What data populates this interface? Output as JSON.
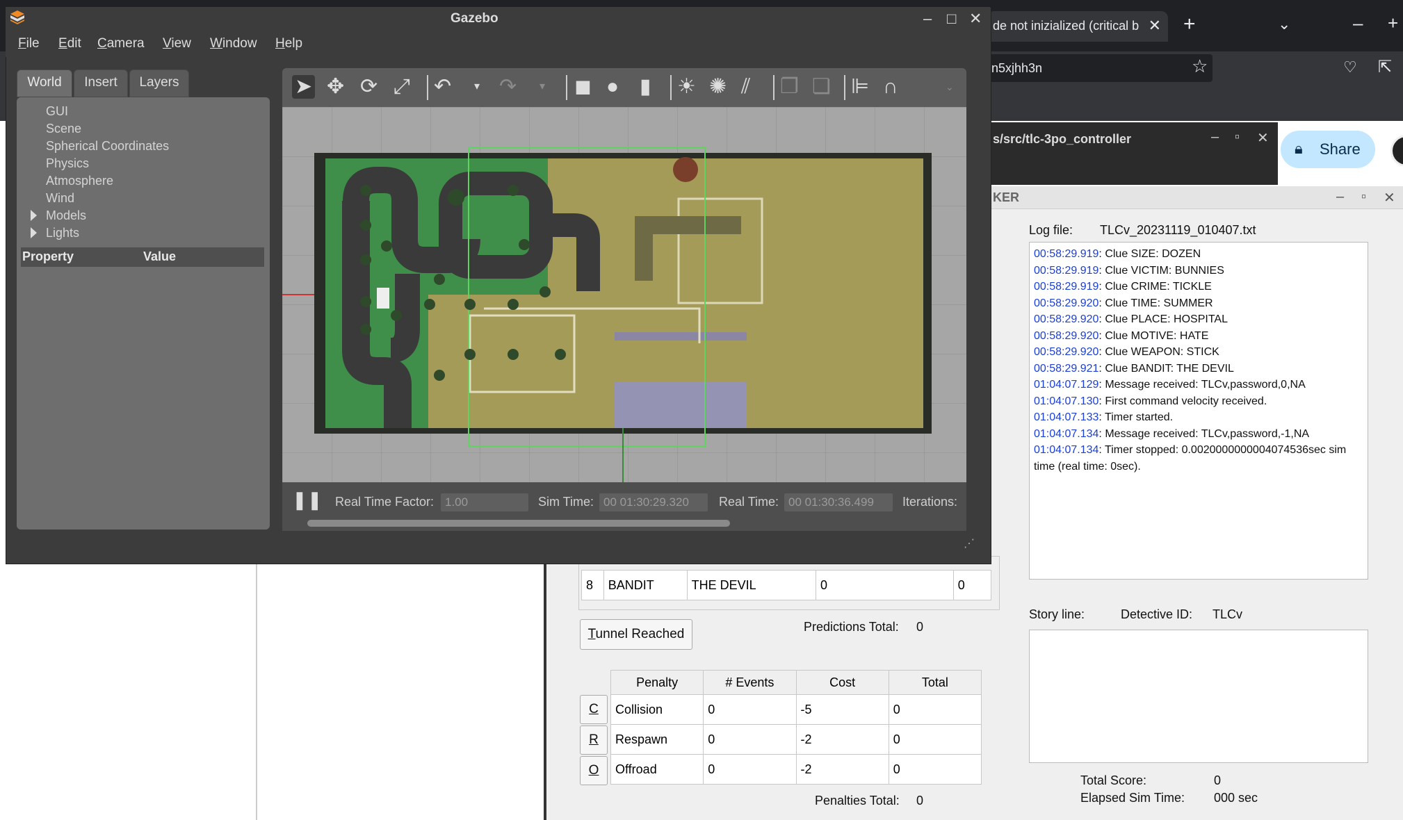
{
  "browser": {
    "tab_title": "de not inizialized (critical b",
    "tab_close": "✕",
    "new_tab": "+",
    "tab_dropdown": "⌄",
    "minimize": "–",
    "plus": "+",
    "url_text": "n5xjhh3n",
    "share_label": "Share"
  },
  "terminal": {
    "title": "s/src/tlc-3po_controller",
    "min": "–",
    "max": "▫",
    "close": "✕"
  },
  "tracker": {
    "title": "KER",
    "min": "–",
    "max": "▫",
    "close": "✕",
    "log_file_label": "Log file:",
    "log_file_name": "TLCv_20231119_010407.txt",
    "log": [
      {
        "ts": "00:58:29.919",
        "msg": ": Clue SIZE: DOZEN"
      },
      {
        "ts": "00:58:29.919",
        "msg": ": Clue VICTIM: BUNNIES"
      },
      {
        "ts": "00:58:29.919",
        "msg": ": Clue CRIME: TICKLE"
      },
      {
        "ts": "00:58:29.920",
        "msg": ": Clue TIME: SUMMER"
      },
      {
        "ts": "00:58:29.920",
        "msg": ": Clue PLACE: HOSPITAL"
      },
      {
        "ts": "00:58:29.920",
        "msg": ": Clue MOTIVE: HATE"
      },
      {
        "ts": "00:58:29.920",
        "msg": ": Clue WEAPON: STICK"
      },
      {
        "ts": "00:58:29.921",
        "msg": ": Clue BANDIT: THE DEVIL"
      },
      {
        "ts": "01:04:07.129",
        "msg": ": Message received: TLCv,password,0,NA"
      },
      {
        "ts": "01:04:07.130",
        "msg": ": First command velocity received."
      },
      {
        "ts": "01:04:07.133",
        "msg": ": Timer started."
      },
      {
        "ts": "01:04:07.134",
        "msg": ": Message received: TLCv,password,-1,NA"
      },
      {
        "ts": "01:04:07.134",
        "msg": ": Timer stopped: 0.0020000000004074536sec sim"
      },
      {
        "ts": "",
        "msg": "time (real time: 0sec)."
      }
    ],
    "clue_row": {
      "num": "8",
      "type": "BANDIT",
      "value": "THE DEVIL",
      "pred": "0",
      "pts": "0"
    },
    "tunnel_button": "Tunnel Reached",
    "tunnel_underline": "T",
    "tunnel_rest": "unnel Reached",
    "predictions_total_label": "Predictions Total:",
    "predictions_total_value": "0",
    "story_label": "Story line:",
    "detective_label": "Detective ID:",
    "detective_value": "TLCv",
    "penalty_headers": [
      "Penalty",
      "# Events",
      "Cost",
      "Total"
    ],
    "penalties": [
      {
        "key": "C",
        "name": "Collision",
        "events": "0",
        "cost": "-5",
        "total": "0"
      },
      {
        "key": "R",
        "name": "Respawn",
        "events": "0",
        "cost": "-2",
        "total": "0"
      },
      {
        "key": "O",
        "name": "Offroad",
        "events": "0",
        "cost": "-2",
        "total": "0"
      }
    ],
    "penalties_total_label": "Penalties Total:",
    "penalties_total_value": "0",
    "total_score_label": "Total Score:",
    "total_score_value": "0",
    "elapsed_label": "Elapsed Sim Time:",
    "elapsed_value": "000 sec"
  },
  "gazebo": {
    "title": "Gazebo",
    "min": "–",
    "max": "□",
    "close": "✕",
    "menus": [
      {
        "u": "F",
        "rest": "ile"
      },
      {
        "u": "E",
        "rest": "dit"
      },
      {
        "u": "C",
        "rest": "amera"
      },
      {
        "u": "V",
        "rest": "iew"
      },
      {
        "u": "W",
        "rest": "indow"
      },
      {
        "u": "H",
        "rest": "elp"
      }
    ],
    "tabs": [
      "World",
      "Insert",
      "Layers"
    ],
    "tree": [
      "GUI",
      "Scene",
      "Spherical Coordinates",
      "Physics",
      "Atmosphere",
      "Wind",
      "Models",
      "Lights"
    ],
    "property_header": "Property",
    "value_header": "Value",
    "rtf_label": "Real Time Factor:",
    "rtf_value": "1.00",
    "sim_time_label": "Sim Time:",
    "sim_time_value": "00 01:30:29.320",
    "real_time_label": "Real Time:",
    "real_time_value": "00 01:30:36.499",
    "iterations_label": "Iterations:"
  },
  "colors": {
    "timestamp_blue": "#1a3fd8",
    "grass_green": "#3f8f4a",
    "track_gray": "#3a3a3a"
  }
}
